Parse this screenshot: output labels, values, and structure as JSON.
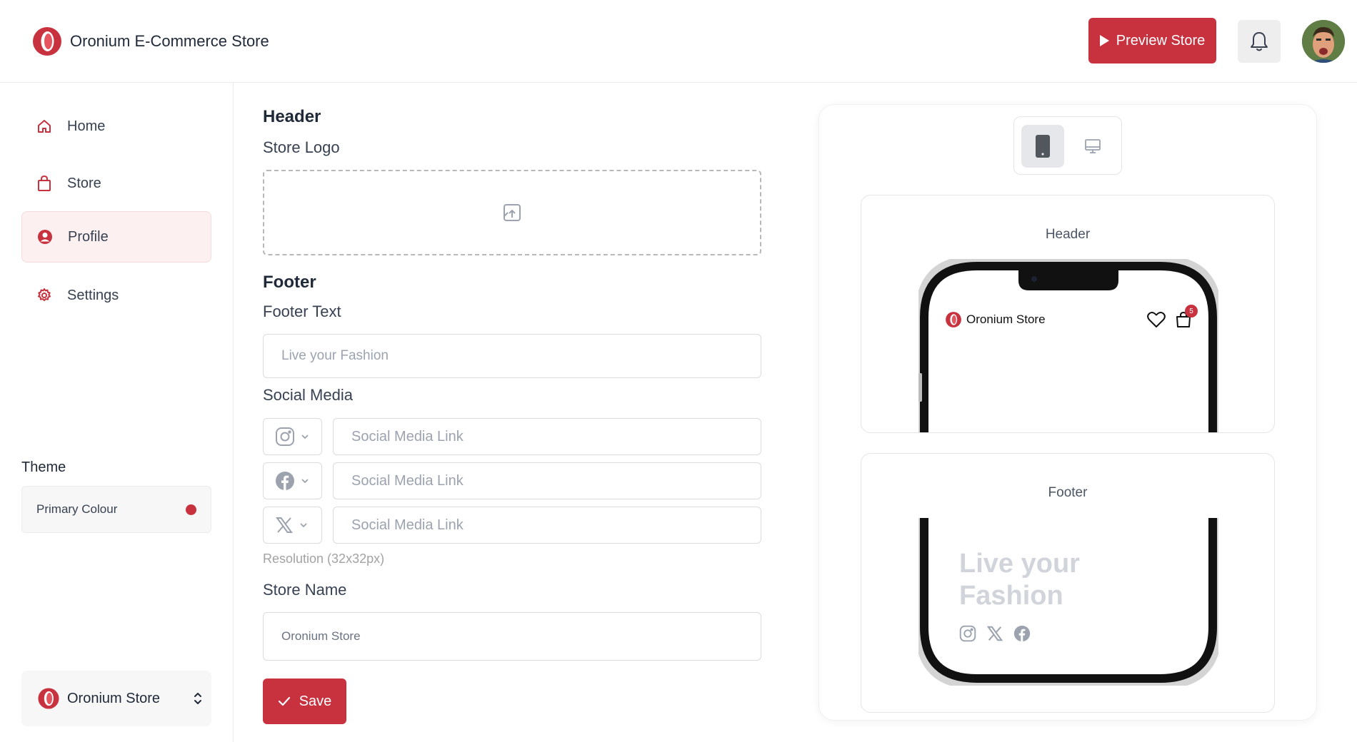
{
  "app": {
    "title": "Oronium E-Commerce Store",
    "brand_color": "#c8323f"
  },
  "topbar": {
    "preview_label": "Preview Store",
    "bell_icon": "bell-icon",
    "avatar": "user-avatar"
  },
  "sidebar": {
    "items": [
      {
        "label": "Home",
        "icon": "home-icon"
      },
      {
        "label": "Store",
        "icon": "shopping-bag-icon"
      },
      {
        "label": "Profile",
        "icon": "user-circle-icon",
        "active": true
      },
      {
        "label": "Settings",
        "icon": "gear-icon"
      }
    ],
    "theme_label": "Theme",
    "primary_colour_label": "Primary Colour",
    "primary_colour": "#c8323f",
    "store_switcher_label": "Oronium Store"
  },
  "form": {
    "header_heading": "Header",
    "store_logo_label": "Store Logo",
    "upload_icon": "image-upload-icon",
    "footer_heading": "Footer",
    "footer_text_label": "Footer Text",
    "footer_text_placeholder": "Live your Fashion",
    "social_media_label": "Social Media",
    "social_links": [
      {
        "icon": "instagram-icon",
        "placeholder": "Social Media Link"
      },
      {
        "icon": "facebook-icon",
        "placeholder": "Social Media Link"
      },
      {
        "icon": "x-icon",
        "placeholder": "Social Media Link"
      }
    ],
    "resolution_hint": "Resolution (32x32px)",
    "store_name_label": "Store Name",
    "store_name_value": "Oronium Store",
    "save_label": "Save"
  },
  "preview": {
    "header_title": "Header",
    "footer_title": "Footer",
    "store_name": "Oronium Store",
    "cart_count": "5",
    "tagline": "Live your Fashion",
    "footer_icons": [
      "instagram-icon",
      "x-icon",
      "facebook-icon"
    ]
  }
}
